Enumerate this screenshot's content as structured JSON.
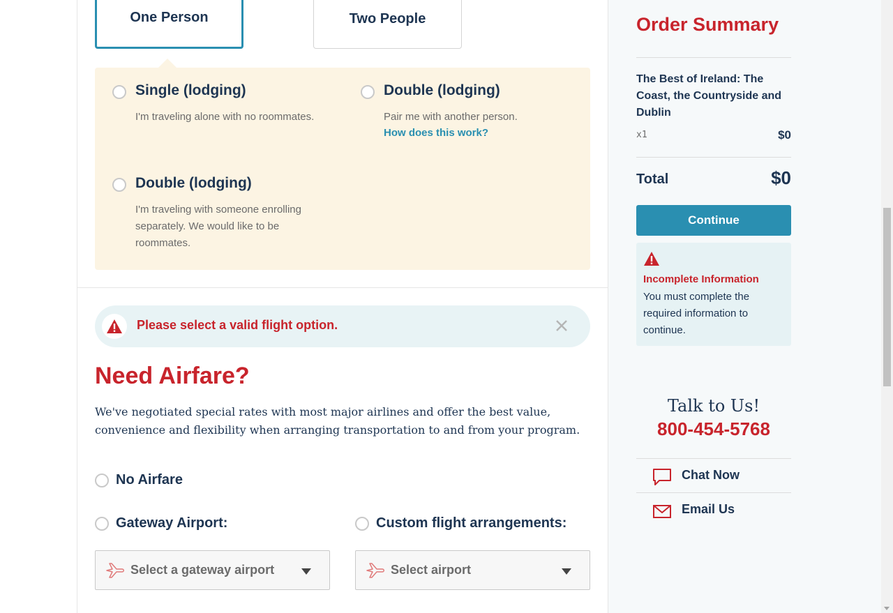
{
  "roommate_cards": {
    "one_person": "One Person",
    "two_people": "Two People"
  },
  "lodging": {
    "options": [
      {
        "title": "Single (lodging)",
        "description": "I'm traveling alone with no roommates."
      },
      {
        "title": "Double (lodging)",
        "description": "Pair me with another person.",
        "link": "How does this work?"
      },
      {
        "title": "Double (lodging)",
        "description": "I'm traveling with someone enrolling separately. We would like to be roommates."
      }
    ]
  },
  "flight_alert": {
    "message": "Please select a valid flight option."
  },
  "airfare": {
    "title": "Need Airfare?",
    "description": "We've negotiated special rates with most major airlines and offer the best value, convenience and flexibility when arranging transportation to and from your program.",
    "no_airfare_label": "No Airfare",
    "gateway_label": "Gateway Airport:",
    "custom_label": "Custom flight arrangements:",
    "gateway_placeholder": "Select a gateway airport",
    "custom_placeholder": "Select airport"
  },
  "order_summary": {
    "title": "Order Summary",
    "trip_name": "The Best of Ireland: The Coast, the Countryside and Dublin",
    "quantity": "x1",
    "price": "$0",
    "total_label": "Total",
    "total_value": "$0",
    "continue_label": "Continue",
    "warning_title": "Incomplete Information",
    "warning_text": "You must complete the required information to continue."
  },
  "contact": {
    "title": "Talk to Us!",
    "phone": "800-454-5768",
    "chat_label": "Chat Now",
    "email_label": "Email Us"
  },
  "colors": {
    "brand_red": "#c8242c",
    "accent_blue": "#2a8fb1",
    "navy_text": "#1e3552",
    "lodging_bg": "#fcf4e3"
  }
}
